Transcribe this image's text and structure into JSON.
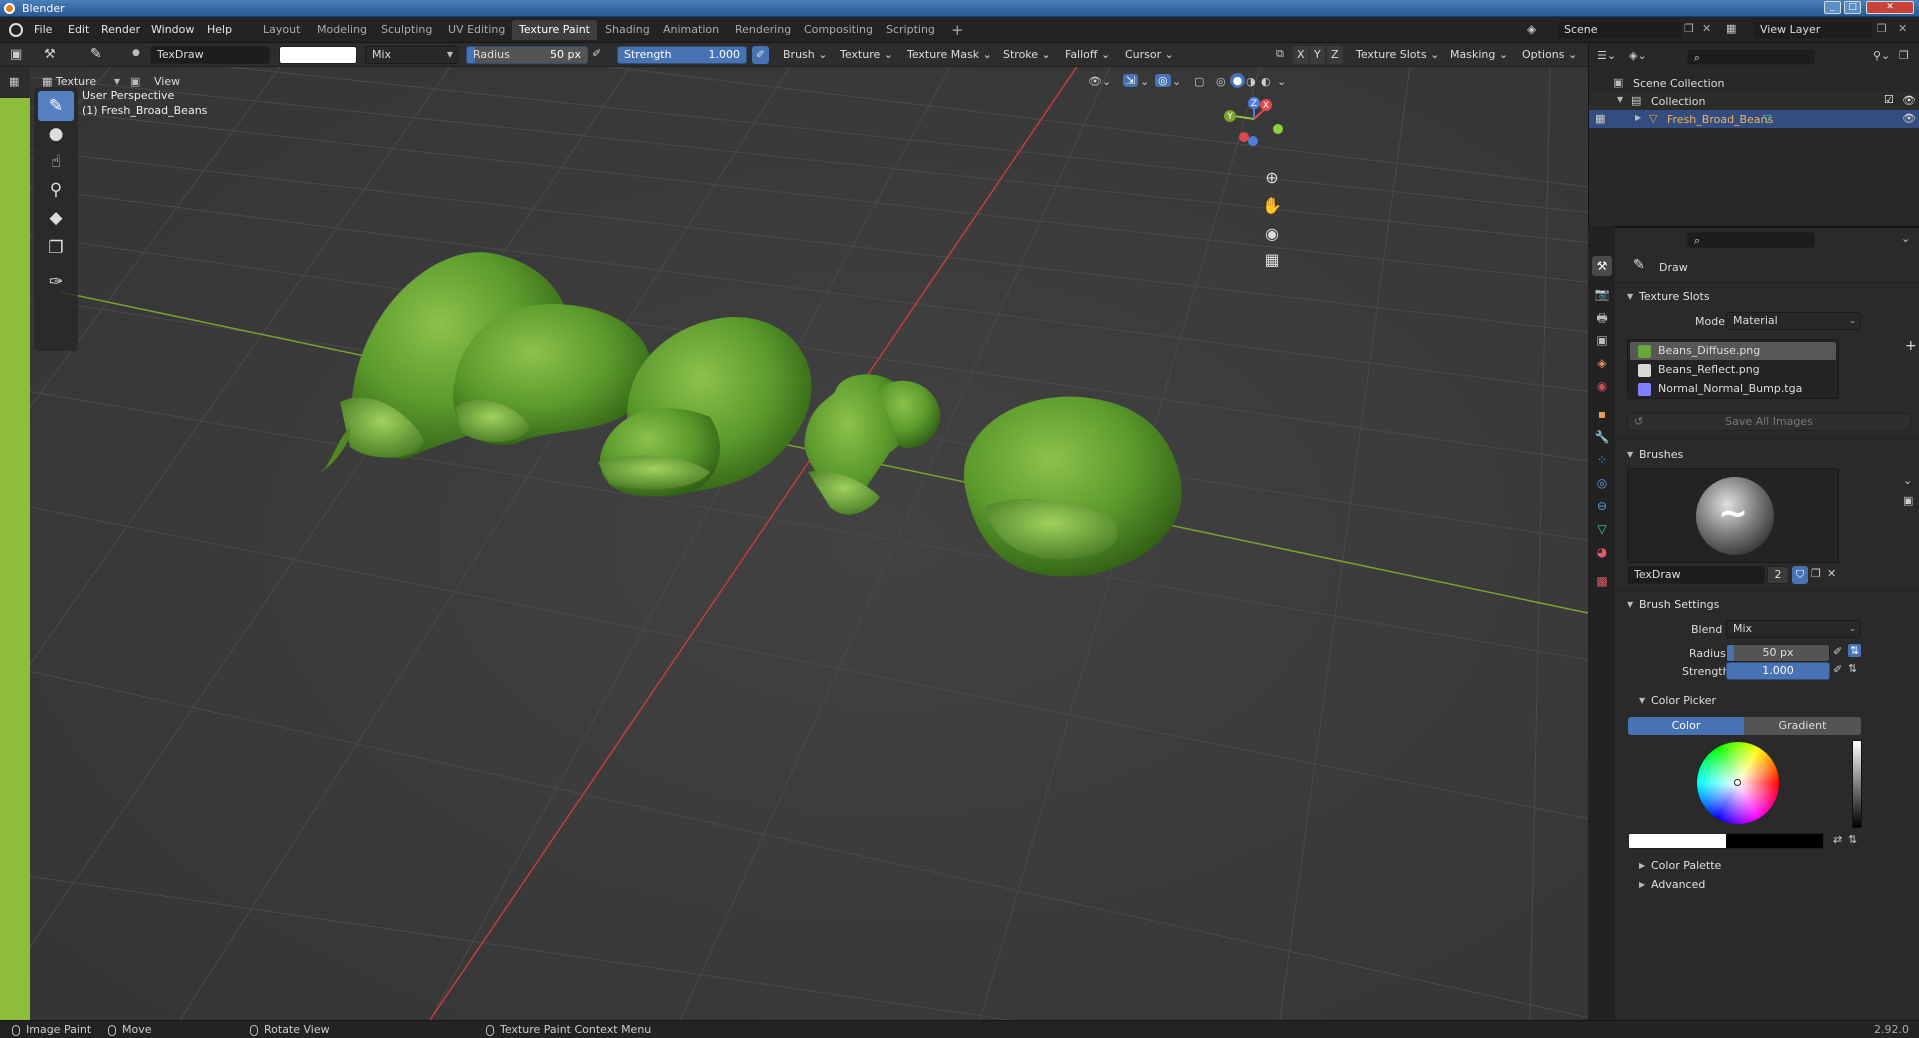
{
  "window": {
    "title": "Blender"
  },
  "menu": [
    "File",
    "Edit",
    "Render",
    "Window",
    "Help"
  ],
  "workspaces": [
    "Layout",
    "Modeling",
    "Sculpting",
    "UV Editing",
    "Texture Paint",
    "Shading",
    "Animation",
    "Rendering",
    "Compositing",
    "Scripting"
  ],
  "active_workspace": "Texture Paint",
  "scene": "Scene",
  "view_layer": "View Layer",
  "tool_header": {
    "brush_name": "TexDraw",
    "blend": "Mix",
    "radius_label": "Radius",
    "radius_value": "50 px",
    "strength_label": "Strength",
    "strength_value": "1.000",
    "menus": [
      "Brush",
      "Texture",
      "Texture Mask",
      "Stroke",
      "Falloff",
      "Cursor"
    ],
    "axis": [
      "X",
      "Y",
      "Z"
    ],
    "right_menus": [
      "Texture Slots",
      "Masking",
      "Options"
    ]
  },
  "viewport_header": {
    "mode": "Texture Paint",
    "view": "View"
  },
  "viewport": {
    "perspective": "User Perspective",
    "object": "(1) Fresh_Broad_Beans",
    "gizmo_labels": [
      "Z",
      "Y",
      "X"
    ]
  },
  "outliner": {
    "scene_collection": "Scene Collection",
    "collection": "Collection",
    "object": "Fresh_Broad_Beans"
  },
  "properties": {
    "tool_name": "Draw",
    "texture_slots_title": "Texture Slots",
    "mode_label": "Mode",
    "mode_value": "Material",
    "slots": [
      {
        "name": "Beans_Diffuse.png",
        "color": "#6aa63a"
      },
      {
        "name": "Beans_Reflect.png",
        "color": "#d8d8d8"
      },
      {
        "name": "Normal_Normal_Bump.tga",
        "color": "#8080ff"
      }
    ],
    "save_all": "Save All Images",
    "brushes_title": "Brushes",
    "brush_name": "TexDraw",
    "brush_users": "2",
    "brush_settings_title": "Brush Settings",
    "blend_label": "Blend",
    "blend_value": "Mix",
    "radius_label": "Radius",
    "radius_value": "50 px",
    "strength_label": "Strength",
    "strength_value": "1.000",
    "color_picker_title": "Color Picker",
    "color_tab": "Color",
    "gradient_tab": "Gradient",
    "color_palette": "Color Palette",
    "advanced": "Advanced"
  },
  "status": {
    "items": [
      "Image Paint",
      "Move",
      "Rotate View",
      "Texture Paint Context Menu"
    ],
    "version": "2.92.0"
  },
  "colors": {
    "accent": "#4772b3",
    "bean": "#5a9a2a",
    "grid_bg": "#3b3b3b",
    "x_axis": "#c33c3c",
    "y_axis": "#7aa22e"
  }
}
